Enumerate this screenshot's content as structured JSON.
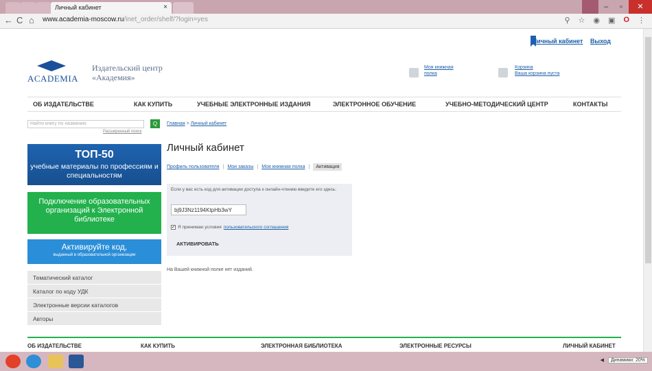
{
  "browser": {
    "tab_title": "Личный кабинет",
    "tab_close": "×",
    "url_host": "www.academia-moscow.ru",
    "url_path": "/inet_order/shelf/?login=yes",
    "win_min": "–",
    "win_max": "▫",
    "win_close": "✕"
  },
  "header": {
    "top_links": [
      "Личный кабинет",
      "Выход"
    ],
    "logo_word": "ACADEMIA",
    "logo_title_1": "Издательский центр",
    "logo_title_2": "«Академия»",
    "shelf_link_1": "Моя книжная",
    "shelf_link_2": "полка",
    "cart_link": "Корзина",
    "cart_status": "Ваша корзина пуста"
  },
  "mainnav": [
    "ОБ ИЗДАТЕЛЬСТВЕ",
    "КАК КУПИТЬ",
    "УЧЕБНЫЕ ЭЛЕКТРОННЫЕ ИЗДАНИЯ",
    "ЭЛЕКТРОННОЕ ОБУЧЕНИЕ",
    "УЧЕБНО-МЕТОДИЧЕСКИЙ ЦЕНТР",
    "КОНТАКТЫ"
  ],
  "sidebar": {
    "search_placeholder": "Найти книгу по названию",
    "search_btn": "Q",
    "advanced_search": "Расширенный поиск",
    "top50_title": "ТОП-50",
    "top50_sub": "учебные материалы по профессиям и специальностям",
    "connect_text": "Подключение образовательных организаций к Электронной библиотеке",
    "activate_title": "Активируйте код,",
    "activate_sub": "выданный в образовательной организации",
    "menu": [
      "Тематический каталог",
      "Каталог по коду УДК",
      "Электронные версии каталогов",
      "Авторы"
    ]
  },
  "content": {
    "breadcrumb_home": "Главная",
    "breadcrumb_sep": " > ",
    "breadcrumb_current": "Личный кабинет",
    "title": "Личный кабинет",
    "tabs": [
      "Профиль пользователя",
      "Мои заказы",
      "Моя книжная полка",
      "Активация"
    ],
    "tab_sep": "|",
    "hint": "Если у вас есть код для активации доступа к онлайн-чтению введите его здесь:",
    "code_value": "bj9J3Nz1194KtpHb3wY",
    "agree_text": "Я принимаю условия",
    "agree_link": "пользовательского соглашения",
    "activate_btn": "АКТИВИРОВАТЬ",
    "empty_msg": "На Вашей книжной полке нет изданий."
  },
  "footer": {
    "nav": [
      "ОБ ИЗДАТЕЛЬСТВЕ",
      "КАК КУПИТЬ",
      "ЭЛЕКТРОННАЯ БИБЛИОТЕКА",
      "ЭЛЕКТРОННЫЕ РЕСУРСЫ",
      "ЛИЧНЫЙ КАБИНЕТ"
    ]
  },
  "taskbar": {
    "tray_label": "Динамики: 20%"
  },
  "colors": {
    "brand_blue": "#1c4f99",
    "green": "#22b14c",
    "link": "#1a5ea8"
  }
}
